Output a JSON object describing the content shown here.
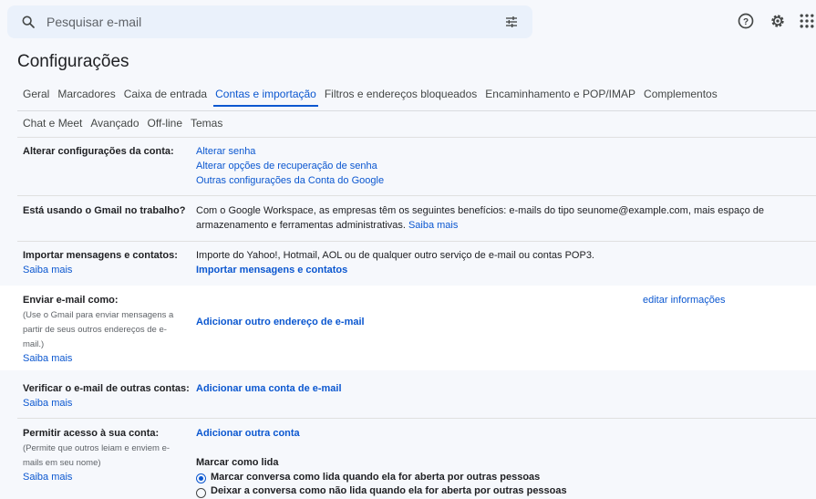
{
  "search": {
    "placeholder": "Pesquisar e-mail"
  },
  "icons": {
    "search": "search-icon",
    "tune": "tune-icon",
    "help": "help-icon",
    "settings": "gear-icon",
    "apps": "apps-icon"
  },
  "colors": {
    "accent": "#0b57d0",
    "bg": "#f6f8fc",
    "search_bg": "#eaf1fb"
  },
  "page_title": "Configurações",
  "tabs_row1": [
    "Geral",
    "Marcadores",
    "Caixa de entrada",
    "Contas e importação",
    "Filtros e endereços bloqueados",
    "Encaminhamento e POP/IMAP",
    "Complementos"
  ],
  "tabs_row2": [
    "Chat e Meet",
    "Avançado",
    "Off-line",
    "Temas"
  ],
  "sections": {
    "account": {
      "label": "Alterar configurações da conta:",
      "links": [
        "Alterar senha",
        "Alterar opções de recuperação de senha",
        "Outras configurações da Conta do Google"
      ]
    },
    "work": {
      "label": "Está usando o Gmail no trabalho?",
      "text": "Com o Google Workspace, as empresas têm os seguintes benefícios: e-mails do tipo seunome@example.com, mais espaço de armazenamento e ferramentas administrativas.",
      "link": "Saiba mais"
    },
    "import": {
      "label": "Importar mensagens e contatos:",
      "learn": "Saiba mais",
      "text": "Importe do Yahoo!, Hotmail, AOL ou de qualquer outro serviço de e-mail ou contas POP3.",
      "action": "Importar mensagens e contatos"
    },
    "send_as": {
      "label": "Enviar e-mail como:",
      "sub": "(Use o Gmail para enviar mensagens a partir de seus outros endereços de e-mail.)",
      "learn": "Saiba mais",
      "action": "Adicionar outro endereço de e-mail",
      "edit": "editar informações"
    },
    "check": {
      "label": "Verificar o e-mail de outras contas:",
      "learn": "Saiba mais",
      "action": "Adicionar uma conta de e-mail"
    },
    "grant": {
      "label": "Permitir acesso à sua conta:",
      "sub": "(Permite que outros leiam e enviem e-mails em seu nome)",
      "learn": "Saiba mais",
      "action": "Adicionar outra conta",
      "mark_title": "Marcar como lida",
      "opt1": "Marcar conversa como lida quando ela for aberta por outras pessoas",
      "opt2": "Deixar a conversa como não lida quando ela for aberta por outras pessoas",
      "selected": 1
    }
  }
}
